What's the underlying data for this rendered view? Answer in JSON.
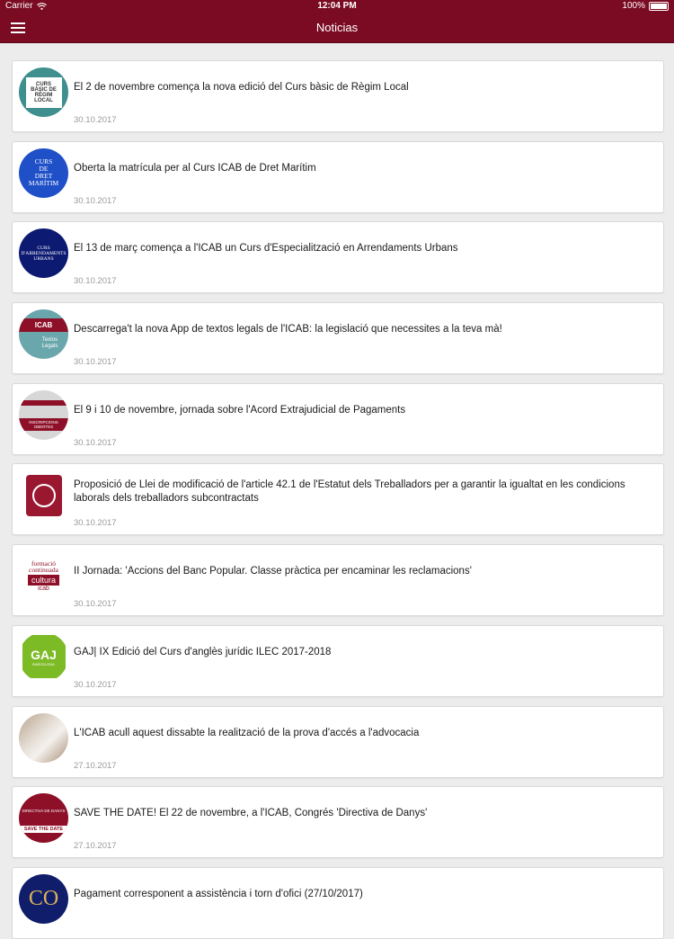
{
  "statusbar": {
    "carrier": "Carrier",
    "time": "12:04 PM",
    "battery": "100%"
  },
  "nav": {
    "title": "Noticias"
  },
  "thumbs": {
    "t0": "CURS\nBÀSIC DE\nRÈGIM LOCAL",
    "t1": "CURS\nDE\nDRET\nMARÍTIM",
    "t2": "CURS\nD'ARRENDAMENTS\nURBANS",
    "t3a": "ICAB",
    "t3b": "Textos\nLegals",
    "t4": "INSCRIPCIONS OBERTES",
    "t6a": "formació\ncontinuada",
    "t6b": "cultura",
    "t6c": "icab",
    "t7a": "GAJ",
    "t7b": "BARCELONA",
    "t9a": "DIRECTIVA DE DANYS",
    "t9b": "SAVE THE DATE",
    "t10": "CO"
  },
  "news": [
    {
      "title": "El 2 de novembre comença la nova edició del Curs bàsic de Règim Local",
      "date": "30.10.2017"
    },
    {
      "title": "Oberta la matrícula per al Curs ICAB de Dret Marítim",
      "date": "30.10.2017"
    },
    {
      "title": "El 13 de març comença a l'ICAB un Curs d'Especialització en Arrendaments Urbans",
      "date": "30.10.2017"
    },
    {
      "title": "Descarrega't la nova App de textos legals de l'ICAB: la legislació que necessites a la teva mà!",
      "date": "30.10.2017"
    },
    {
      "title": "El 9 i 10 de novembre, jornada sobre l'Acord Extrajudicial de Pagaments",
      "date": "30.10.2017"
    },
    {
      "title": "Proposició de Llei de modificació de l'article 42.1 de l'Estatut dels Treballadors per a garantir la igualtat en les condicions laborals dels treballadors subcontractats",
      "date": "30.10.2017"
    },
    {
      "title": "II Jornada: 'Accions del Banc Popular. Classe pràctica per encaminar les reclamacions'",
      "date": "30.10.2017"
    },
    {
      "title": "GAJ| IX Edició del Curs d'anglès jurídic ILEC 2017-2018",
      "date": "30.10.2017"
    },
    {
      "title": "L'ICAB acull aquest dissabte la realització de la prova d'accés a l'advocacia",
      "date": "27.10.2017"
    },
    {
      "title": "SAVE THE DATE! El 22 de novembre, a l'ICAB, Congrés 'Directiva de Danys'",
      "date": "27.10.2017"
    },
    {
      "title": "Pagament corresponent a assistència i torn d'ofici (27/10/2017)",
      "date": ""
    }
  ],
  "colors": {
    "brand": "#7a0b22",
    "background": "#ececec",
    "date": "#9a9a9a"
  }
}
